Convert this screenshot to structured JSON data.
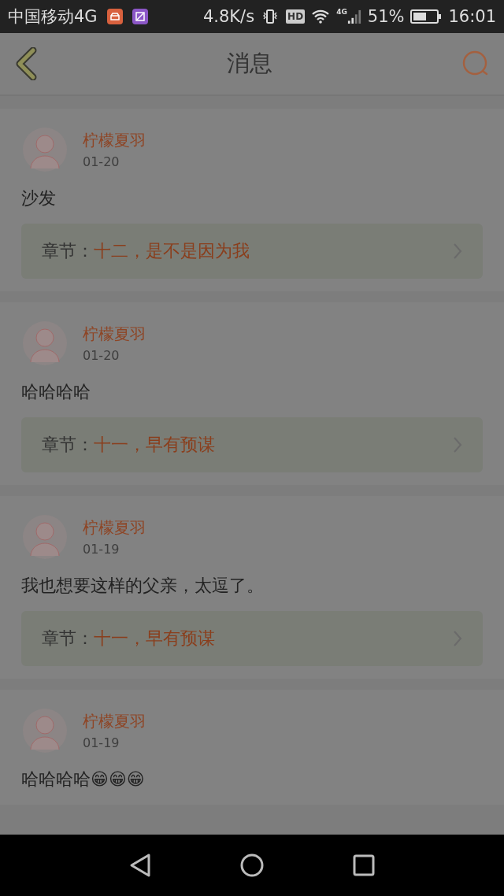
{
  "status_bar": {
    "carrier": "中国移动4G",
    "speed": "4.8K/s",
    "hd": "HD",
    "network": "4G",
    "battery": "51%",
    "time": "16:01"
  },
  "header": {
    "title": "消息"
  },
  "messages": [
    {
      "user": "柠檬夏羽",
      "date": "01-20",
      "text": "沙发",
      "chapter": {
        "label": "章节：",
        "title": "十二，是不是因为我"
      }
    },
    {
      "user": "柠檬夏羽",
      "date": "01-20",
      "text": "哈哈哈哈",
      "chapter": {
        "label": "章节：",
        "title": "十一，早有预谋"
      }
    },
    {
      "user": "柠檬夏羽",
      "date": "01-19",
      "text": "我也想要这样的父亲，太逗了。",
      "chapter": {
        "label": "章节：",
        "title": "十一，早有预谋"
      }
    },
    {
      "user": "柠檬夏羽",
      "date": "01-19",
      "text": "哈哈哈哈😁😁😁"
    }
  ]
}
